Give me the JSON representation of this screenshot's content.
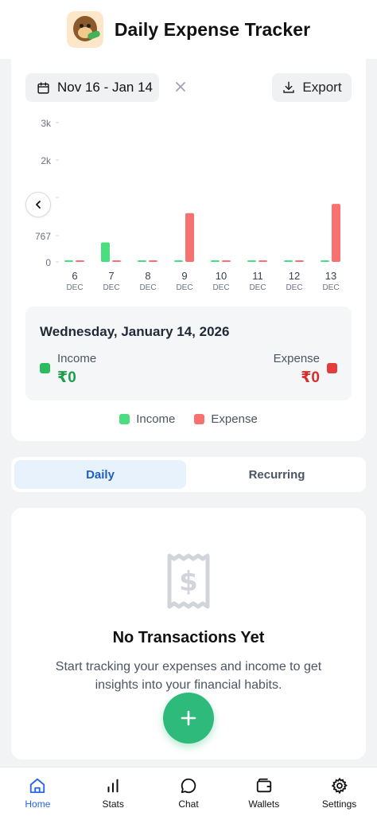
{
  "header": {
    "title": "Daily Expense Tracker",
    "logo_icon": "monkey-logo-icon"
  },
  "filters": {
    "date_range": "Nov 16 - Jan 14",
    "export_label": "Export"
  },
  "chart_data": {
    "type": "bar",
    "y_ticks": [
      "3k",
      "2k",
      "767",
      "0"
    ],
    "categories": [
      "6",
      "7",
      "8",
      "9",
      "10",
      "11",
      "12",
      "13"
    ],
    "category_month": "DEC",
    "series": [
      {
        "name": "Income",
        "color": "#4ade80",
        "values": [
          0,
          420,
          0,
          0,
          0,
          0,
          0,
          0
        ]
      },
      {
        "name": "Expense",
        "color": "#f87171",
        "values": [
          0,
          0,
          0,
          1050,
          0,
          0,
          0,
          1250
        ]
      }
    ],
    "ylim": [
      0,
      3000
    ]
  },
  "selection": {
    "date": "Wednesday, January 14, 2026",
    "income_label": "Income",
    "income_value": "₹0",
    "expense_label": "Expense",
    "expense_value": "₹0"
  },
  "legend": {
    "income": "Income",
    "expense": "Expense"
  },
  "tabs": {
    "daily": "Daily",
    "recurring": "Recurring"
  },
  "empty_state": {
    "title": "No Transactions Yet",
    "subtitle": "Start tracking your expenses and income to get insights into your financial habits."
  },
  "nav": [
    {
      "label": "Home",
      "icon": "home-icon",
      "active": true
    },
    {
      "label": "Stats",
      "icon": "stats-icon",
      "active": false
    },
    {
      "label": "Chat",
      "icon": "chat-icon",
      "active": false
    },
    {
      "label": "Wallets",
      "icon": "wallet-icon",
      "active": false
    },
    {
      "label": "Settings",
      "icon": "gear-icon",
      "active": false
    }
  ],
  "colors": {
    "income": "#2dbb5f",
    "expense": "#e23c3c",
    "accent": "#2563eb",
    "fab": "#2dba7a"
  }
}
